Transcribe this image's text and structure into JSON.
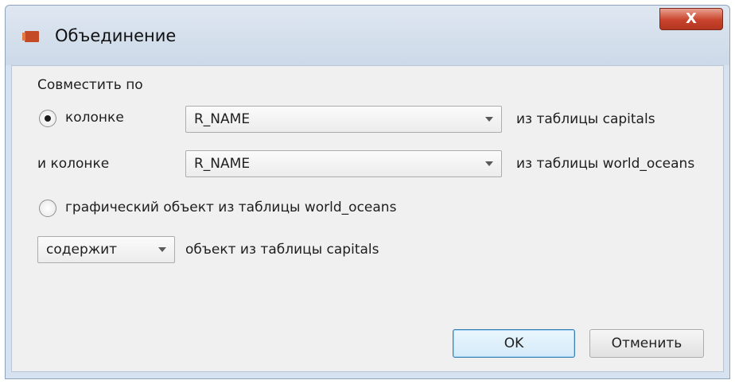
{
  "window": {
    "title": "Объединение",
    "close_glyph": "X"
  },
  "form": {
    "group_label": "Совместить по",
    "option1": {
      "radio_label": "колонке",
      "selected": true,
      "column_value": "R_NAME",
      "suffix": "из таблицы capitals"
    },
    "second_column": {
      "label": "и колонке",
      "column_value": "R_NAME",
      "suffix": "из таблицы world_oceans"
    },
    "option2": {
      "radio_label": "графический объект из таблицы world_oceans",
      "selected": false
    },
    "predicate": {
      "value": "содержит",
      "suffix": "объект из таблицы capitals"
    }
  },
  "buttons": {
    "ok": "OK",
    "cancel": "Отменить"
  }
}
